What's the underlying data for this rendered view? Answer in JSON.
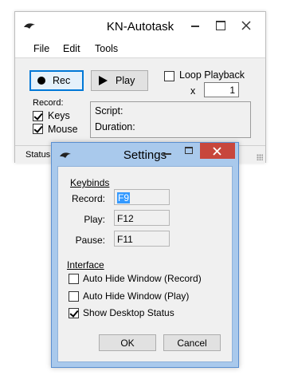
{
  "main_window": {
    "title": "KN-Autotask",
    "menu": [
      "File",
      "Edit",
      "Tools"
    ],
    "rec_label": "Rec",
    "play_label": "Play",
    "loop_label": "Loop Playback",
    "loop_x": "x",
    "loop_count": "1",
    "loop_checked": false,
    "record_label": "Record:",
    "keys_label": "Keys",
    "keys_checked": true,
    "mouse_label": "Mouse",
    "mouse_checked": true,
    "script_label": "Script:",
    "duration_label": "Duration:",
    "status_label": "Status"
  },
  "settings_dialog": {
    "title": "Settings",
    "keybinds_heading": "Keybinds",
    "record_label": "Record:",
    "record_key": "F9",
    "play_label": "Play:",
    "play_key": "F12",
    "pause_label": "Pause:",
    "pause_key": "F11",
    "interface_heading": "Interface",
    "options": [
      {
        "label": "Auto Hide Window (Record)",
        "checked": false
      },
      {
        "label": "Auto Hide Window (Play)",
        "checked": false
      },
      {
        "label": "Show Desktop Status",
        "checked": true
      }
    ],
    "ok_label": "OK",
    "cancel_label": "Cancel"
  },
  "colors": {
    "dialog_frame": "#a9c9ec",
    "close_button": "#c7463c",
    "focus_accent": "#0078d7",
    "selection": "#3399ff"
  },
  "icons": [
    "app-bird-icon",
    "minimize-icon",
    "maximize-icon",
    "close-icon",
    "record-dot-icon",
    "play-triangle-icon",
    "check-icon",
    "resize-grip-icon"
  ]
}
